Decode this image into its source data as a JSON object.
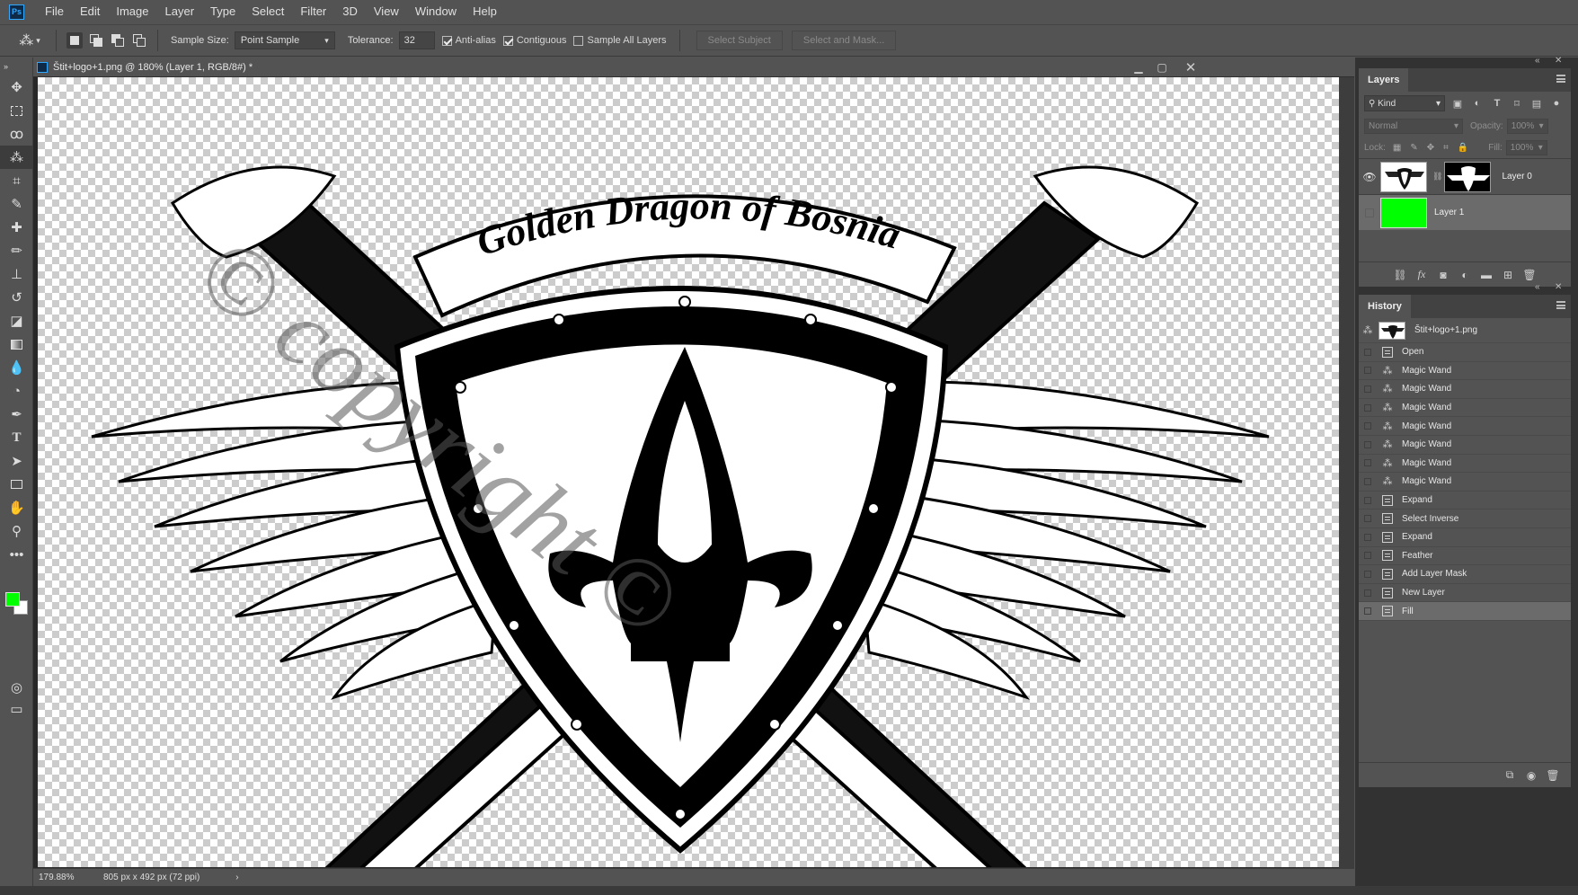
{
  "app": {
    "logo": "Ps",
    "menu": [
      "File",
      "Edit",
      "Image",
      "Layer",
      "Type",
      "Select",
      "Filter",
      "3D",
      "View",
      "Window",
      "Help"
    ]
  },
  "options": {
    "sample_size_label": "Sample Size:",
    "sample_size_value": "Point Sample",
    "tolerance_label": "Tolerance:",
    "tolerance_value": "32",
    "anti_alias_label": "Anti-alias",
    "anti_alias_checked": true,
    "contiguous_label": "Contiguous",
    "contiguous_checked": true,
    "sample_all_label": "Sample All Layers",
    "sample_all_checked": false,
    "select_subject": "Select Subject",
    "select_mask": "Select and Mask..."
  },
  "tools": [
    "move-icon",
    "marquee-icon",
    "lasso-icon",
    "magic-wand-icon",
    "crop-icon",
    "eyedropper-icon",
    "healing-brush-icon",
    "brush-icon",
    "clone-stamp-icon",
    "history-brush-icon",
    "eraser-icon",
    "gradient-icon",
    "blur-icon",
    "dodge-icon",
    "pen-icon",
    "type-icon",
    "path-select-icon",
    "rectangle-icon",
    "hand-icon",
    "zoom-icon",
    "more-tools-icon"
  ],
  "colors": {
    "foreground": "#00ff00",
    "background": "#ffffff",
    "panel_bg": "#535353",
    "selected_row": "#6b6b6b"
  },
  "document": {
    "title": "Štit+logo+1.png @ 180% (Layer 1, RGB/8#) *",
    "banner_text": "Golden Dragon of Bosnia",
    "watermark": "© copyright ©",
    "zoom": "179.88%",
    "doc_info": "805 px x 492 px (72 ppi)"
  },
  "layers_panel": {
    "tab": "Layers",
    "kind": "Kind",
    "blend_mode": "Normal",
    "opacity_label": "Opacity:",
    "opacity_value": "100%",
    "lock_label": "Lock:",
    "fill_label": "Fill:",
    "fill_value": "100%",
    "layers": [
      {
        "name": "Layer 0",
        "visible": true,
        "selected": false
      },
      {
        "name": "Layer 1",
        "visible": false,
        "selected": true
      }
    ]
  },
  "history_panel": {
    "tab": "History",
    "snapshot": "Štit+logo+1.png",
    "items": [
      {
        "label": "Open",
        "icon": "document-icon"
      },
      {
        "label": "Magic Wand",
        "icon": "magic-wand-icon"
      },
      {
        "label": "Magic Wand",
        "icon": "magic-wand-icon"
      },
      {
        "label": "Magic Wand",
        "icon": "magic-wand-icon"
      },
      {
        "label": "Magic Wand",
        "icon": "magic-wand-icon"
      },
      {
        "label": "Magic Wand",
        "icon": "magic-wand-icon"
      },
      {
        "label": "Magic Wand",
        "icon": "magic-wand-icon"
      },
      {
        "label": "Magic Wand",
        "icon": "magic-wand-icon"
      },
      {
        "label": "Expand",
        "icon": "document-icon"
      },
      {
        "label": "Select Inverse",
        "icon": "document-icon"
      },
      {
        "label": "Expand",
        "icon": "document-icon"
      },
      {
        "label": "Feather",
        "icon": "document-icon"
      },
      {
        "label": "Add Layer Mask",
        "icon": "document-icon"
      },
      {
        "label": "New Layer",
        "icon": "document-icon"
      },
      {
        "label": "Fill",
        "icon": "document-icon"
      }
    ]
  }
}
